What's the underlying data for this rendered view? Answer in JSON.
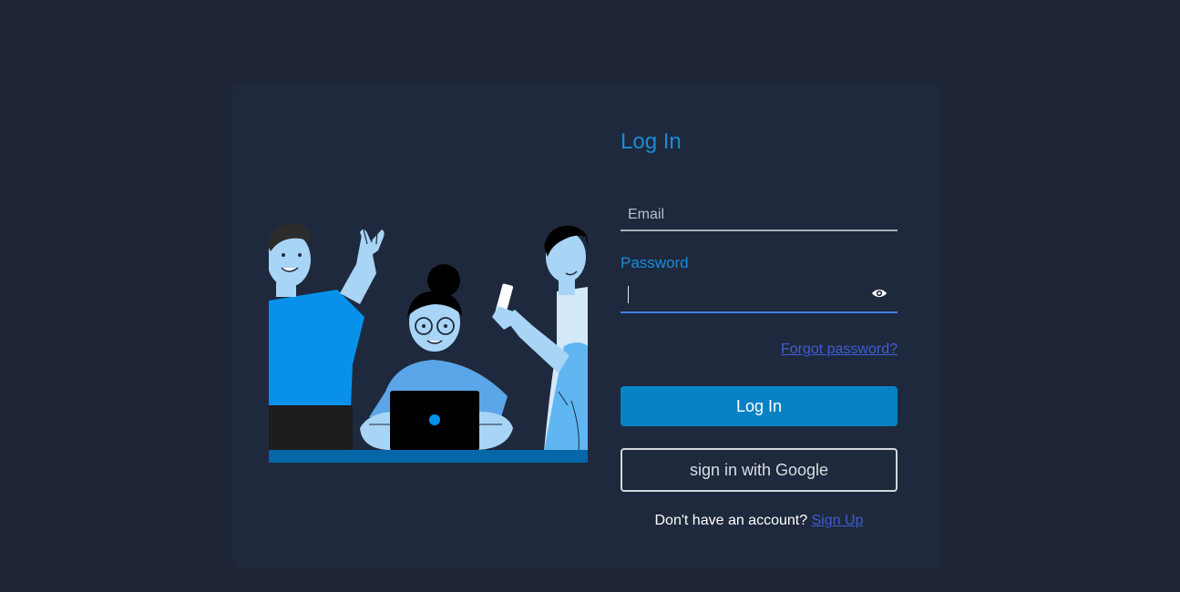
{
  "login": {
    "title": "Log In",
    "email_placeholder": "Email",
    "email_value": "",
    "password_label": "Password",
    "password_value": "",
    "forgot_password": "Forgot password?",
    "login_button": "Log In",
    "google_button": "sign in with Google",
    "no_account_text": "Don't have an account?",
    "signup_link": "Sign Up"
  },
  "icons": {
    "password_toggle": "eye-icon",
    "illustration": "team-illustration"
  },
  "colors": {
    "page_bg": "#1d2537",
    "card_bg": "#1f293d",
    "accent": "#1b8bd6",
    "button": "#0782c4",
    "link": "#3d5fd1"
  }
}
